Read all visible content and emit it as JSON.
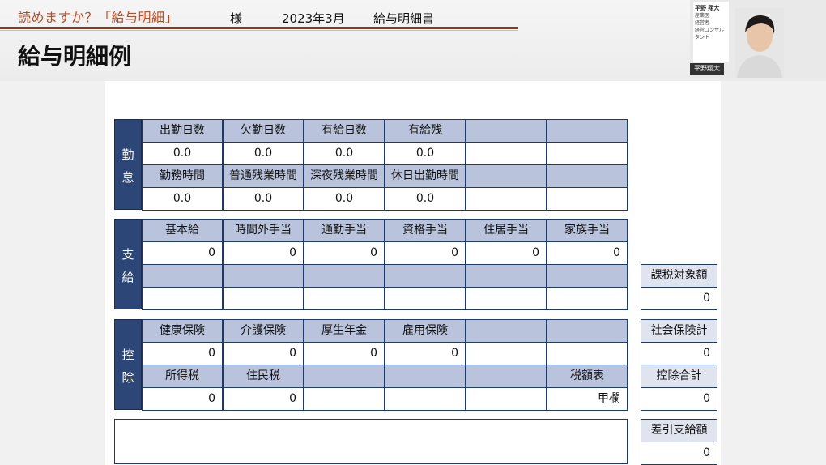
{
  "header": {
    "subtitle": "読めますか？「給与明細」",
    "title": "給与明細例"
  },
  "video": {
    "card_lines": [
      "平野 翔大",
      "産業医",
      "経営者",
      "経営コンサルタント"
    ],
    "name_tag": "平野翔大"
  },
  "slip": {
    "sama": "様",
    "period": "2023年3月",
    "doc_title": "給与明細書"
  },
  "kintai": {
    "side_label": [
      "勤",
      "怠"
    ],
    "row1_headers": [
      "出勤日数",
      "欠勤日数",
      "有給日数",
      "有給残",
      "",
      ""
    ],
    "row1_values": [
      "0.0",
      "0.0",
      "0.0",
      "0.0",
      "",
      ""
    ],
    "row2_headers": [
      "勤務時間",
      "普通残業時間",
      "深夜残業時間",
      "休日出勤時間",
      "",
      ""
    ],
    "row2_values": [
      "0.0",
      "0.0",
      "0.0",
      "0.0",
      "",
      ""
    ]
  },
  "shikyu": {
    "side_label": [
      "支",
      "給"
    ],
    "row1_headers": [
      "基本給",
      "時間外手当",
      "通勤手当",
      "資格手当",
      "住居手当",
      "家族手当"
    ],
    "row1_values": [
      "0",
      "0",
      "0",
      "0",
      "0",
      "0"
    ],
    "row2_headers": [
      "",
      "",
      "",
      "",
      "",
      ""
    ],
    "row2_values": [
      "",
      "",
      "",
      "",
      "",
      ""
    ]
  },
  "kojo": {
    "side_label": [
      "控",
      "除"
    ],
    "row1_headers": [
      "健康保険",
      "介護保険",
      "厚生年金",
      "雇用保険",
      "",
      ""
    ],
    "row1_values": [
      "0",
      "0",
      "0",
      "0",
      "",
      ""
    ],
    "row2_headers": [
      "所得税",
      "住民税",
      "",
      "",
      "",
      "税額表"
    ],
    "row2_values": [
      "0",
      "0",
      "",
      "",
      "",
      "甲欄"
    ]
  },
  "summary": {
    "taxable_label": "課税対象額",
    "taxable_value": "0",
    "social_label": "社会保険計",
    "social_value": "0",
    "deduction_label": "控除合計",
    "deduction_value": "0",
    "net_label": "差引支給額",
    "net_value": "0"
  },
  "colors": {
    "navy": "#2c4677",
    "header_cell": "#b9c4dc",
    "accent": "#8a3b1c"
  }
}
